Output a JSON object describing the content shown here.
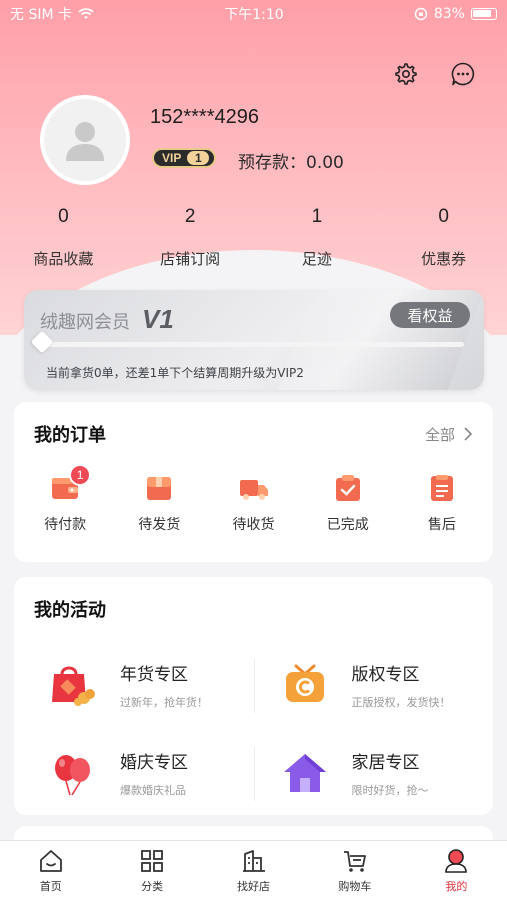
{
  "status_bar": {
    "carrier": "无 SIM 卡",
    "time": "下午1:10",
    "battery": "83%"
  },
  "profile": {
    "phone": "152****4296",
    "vip_label": "VIP",
    "vip_level": "1",
    "deposit": "预存款：0.00"
  },
  "stats": [
    {
      "num": "0",
      "label": "商品收藏"
    },
    {
      "num": "2",
      "label": "店铺订阅"
    },
    {
      "num": "1",
      "label": "足迹"
    },
    {
      "num": "0",
      "label": "优惠券"
    }
  ],
  "member": {
    "title": "绒趣网会员",
    "level": "V1",
    "button": "看权益",
    "tip": "当前拿货0单，还差1单下个结算周期升级为VIP2"
  },
  "orders": {
    "title": "我的订单",
    "more": "全部",
    "items": [
      {
        "label": "待付款",
        "badge": "1",
        "icon": "wallet-icon",
        "color": "#f0604d"
      },
      {
        "label": "待发货",
        "icon": "box-icon",
        "color": "#f0604d"
      },
      {
        "label": "待收货",
        "icon": "truck-icon",
        "color": "#f0604d"
      },
      {
        "label": "已完成",
        "icon": "clipboard-check-icon",
        "color": "#f0604d"
      },
      {
        "label": "售后",
        "icon": "document-icon",
        "color": "#f0604d"
      }
    ]
  },
  "activities": {
    "title": "我的活动",
    "items": [
      {
        "title": "年货专区",
        "sub": "过新年，抢年货！",
        "icon": "new-year-bag-icon"
      },
      {
        "title": "版权专区",
        "sub": "正版授权，发货快！",
        "icon": "copyright-tv-icon"
      },
      {
        "title": "婚庆专区",
        "sub": "爆款婚庆礼品",
        "icon": "balloon-icon"
      },
      {
        "title": "家居专区",
        "sub": "限时好货，抢～",
        "icon": "house-icon"
      }
    ]
  },
  "tabbar": [
    {
      "label": "首页",
      "icon": "home-icon"
    },
    {
      "label": "分类",
      "icon": "grid-icon"
    },
    {
      "label": "找好店",
      "icon": "store-icon"
    },
    {
      "label": "购物车",
      "icon": "cart-icon"
    },
    {
      "label": "我的",
      "icon": "user-icon",
      "active": true
    }
  ],
  "colors": {
    "hero": "#ff9fa8",
    "accent": "#e0313d",
    "order_icon": "#f0604d"
  }
}
